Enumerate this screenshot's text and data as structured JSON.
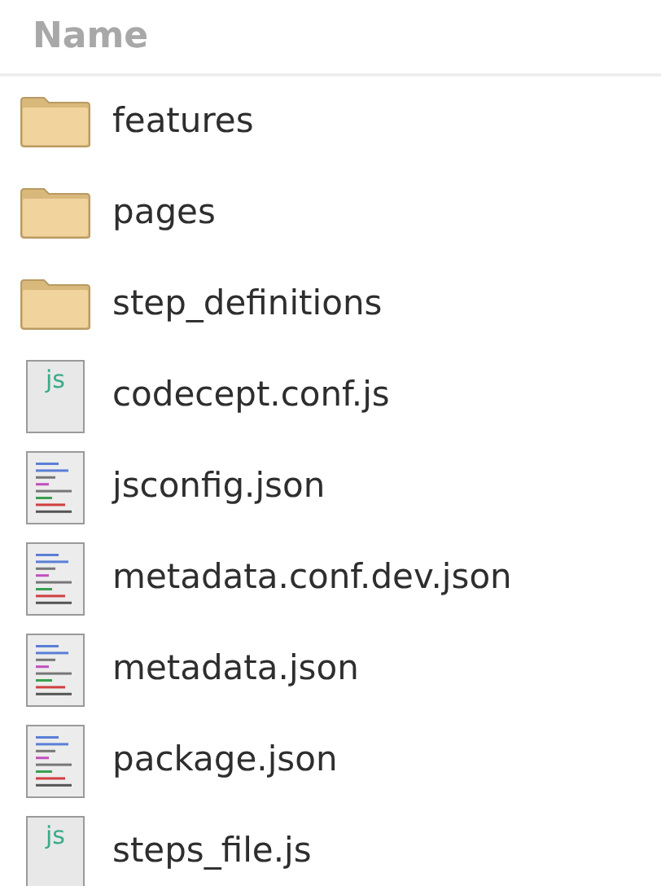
{
  "header": {
    "label": "Name"
  },
  "files": [
    {
      "kind": "folder",
      "name": "features"
    },
    {
      "kind": "folder",
      "name": "pages"
    },
    {
      "kind": "folder",
      "name": "step_definitions"
    },
    {
      "kind": "script",
      "name": "codecept.conf.js",
      "icon_text": "js"
    },
    {
      "kind": "text",
      "name": "jsconfig.json"
    },
    {
      "kind": "text",
      "name": "metadata.conf.dev.json"
    },
    {
      "kind": "text",
      "name": "metadata.json"
    },
    {
      "kind": "text",
      "name": "package.json"
    },
    {
      "kind": "script",
      "name": "steps_file.js",
      "icon_text": "js"
    }
  ]
}
